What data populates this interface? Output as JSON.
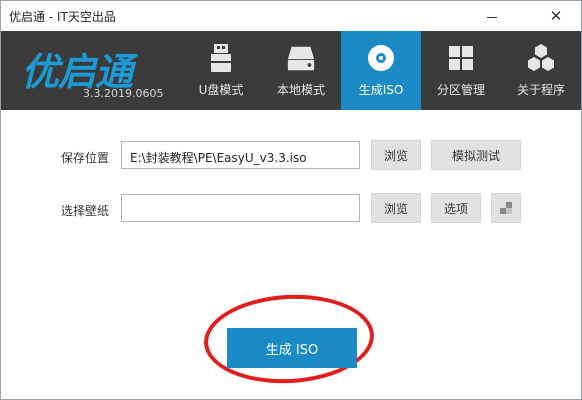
{
  "window": {
    "title": "优启通 - IT天空出品",
    "minimize_icon": "minimize-icon",
    "close_label": "✕"
  },
  "header": {
    "logo_text": "优启通",
    "version": "3.3.2019.0605",
    "tabs": [
      {
        "label": "U盘模式",
        "icon": "usb-drive-icon",
        "active": false
      },
      {
        "label": "本地模式",
        "icon": "hard-disk-icon",
        "active": false
      },
      {
        "label": "生成ISO",
        "icon": "disc-icon",
        "active": true
      },
      {
        "label": "分区管理",
        "icon": "partition-grid-icon",
        "active": false
      },
      {
        "label": "关于程序",
        "icon": "hexagons-icon",
        "active": false
      }
    ]
  },
  "form": {
    "save_location_label": "保存位置",
    "save_location_value": "E:\\封装教程\\PE\\EasyU_v3.3.iso",
    "browse_label_1": "浏览",
    "simulate_test_label": "模拟测试",
    "wallpaper_label": "选择壁纸",
    "wallpaper_value": "",
    "browse_label_2": "浏览",
    "options_label": "选项",
    "wallpaper_preview_icon": "image-preview-icon"
  },
  "primary_button": {
    "label": "生成 ISO"
  },
  "colors": {
    "accent": "#1c8ac4",
    "header_bg": "#3b3b3b",
    "annotation_circle": "#e21d1d"
  }
}
